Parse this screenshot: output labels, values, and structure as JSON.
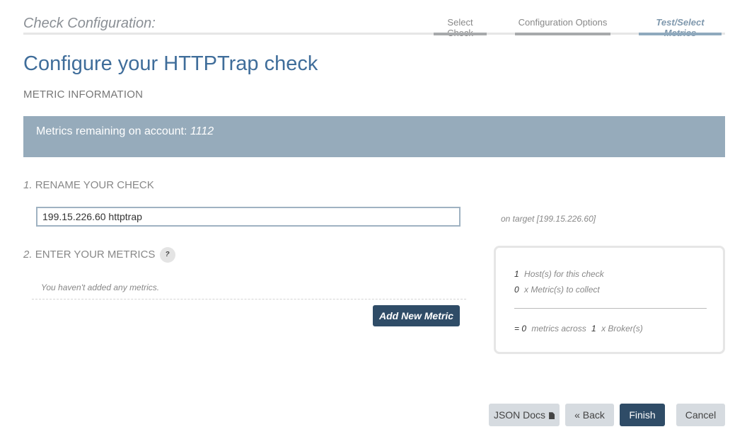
{
  "header": {
    "title": "Check Configuration:",
    "steps": [
      {
        "label": "Select Check"
      },
      {
        "label": "Configuration Options"
      },
      {
        "label": "Test/Select Metrics"
      }
    ]
  },
  "page": {
    "title": "Configure your HTTPTrap check",
    "section_label": "METRIC INFORMATION"
  },
  "banner": {
    "label": "Metrics remaining on account:",
    "value": "1112"
  },
  "rename": {
    "index": "1.",
    "heading": "RENAME YOUR CHECK",
    "value": "199.15.226.60 httptrap",
    "target_note": "on target [199.15.226.60]"
  },
  "metrics": {
    "index": "2.",
    "heading": "ENTER YOUR METRICS",
    "help_glyph": "?",
    "empty_text": "You haven't added any metrics.",
    "add_button": "Add New Metric"
  },
  "summary": {
    "hosts_count": "1",
    "hosts_label": "Host(s) for this check",
    "metrics_count": "0",
    "metrics_label": "x Metric(s) to collect",
    "total_prefix": "= 0",
    "total_mid": "metrics across",
    "brokers_count": "1",
    "brokers_label": "x Broker(s)"
  },
  "footer": {
    "json_docs": "JSON Docs",
    "back": "« Back",
    "finish": "Finish",
    "cancel": "Cancel"
  },
  "colors": {
    "primary_dark": "#2f4c67",
    "banner": "#96abbb",
    "title_blue": "#3f6d9a"
  }
}
